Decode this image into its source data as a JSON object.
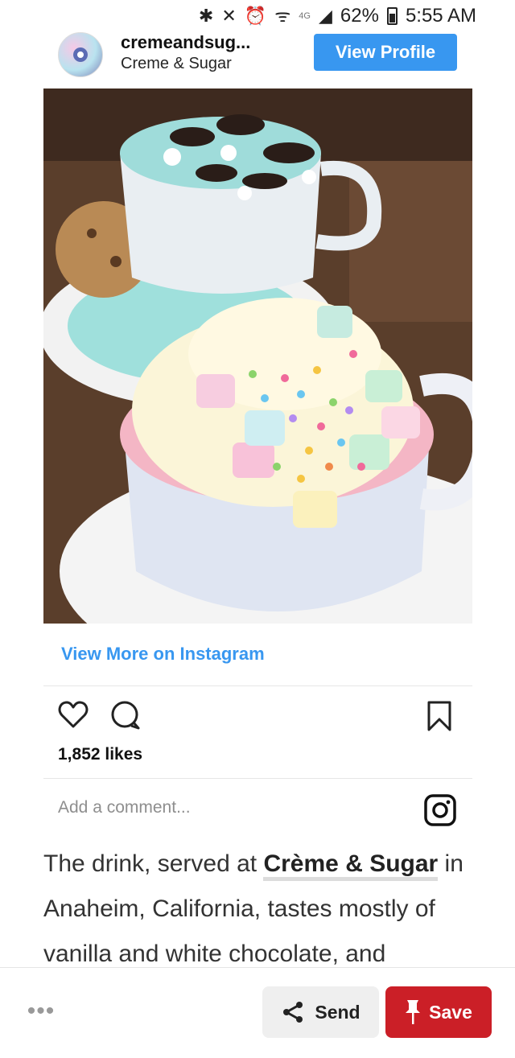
{
  "status_bar": {
    "network": "4G",
    "battery": "62%",
    "time": "5:55 AM"
  },
  "profile": {
    "username": "cremeandsug...",
    "full_name": "Creme & Sugar",
    "view_profile_label": "View Profile"
  },
  "post": {
    "image_alt": "",
    "view_more_label": "View More on Instagram",
    "likes": "1,852 likes",
    "comment_placeholder": "Add a comment..."
  },
  "caption": {
    "part1": "The drink, served at ",
    "link_text": "Crème & Sugar",
    "part2": " in Anaheim, California, tastes mostly of vanilla and white chocolate, and"
  },
  "bottom_bar": {
    "send_label": "Send",
    "save_label": "Save"
  },
  "colors": {
    "instagram_blue": "#3897f0",
    "save_red": "#cb1f27"
  }
}
